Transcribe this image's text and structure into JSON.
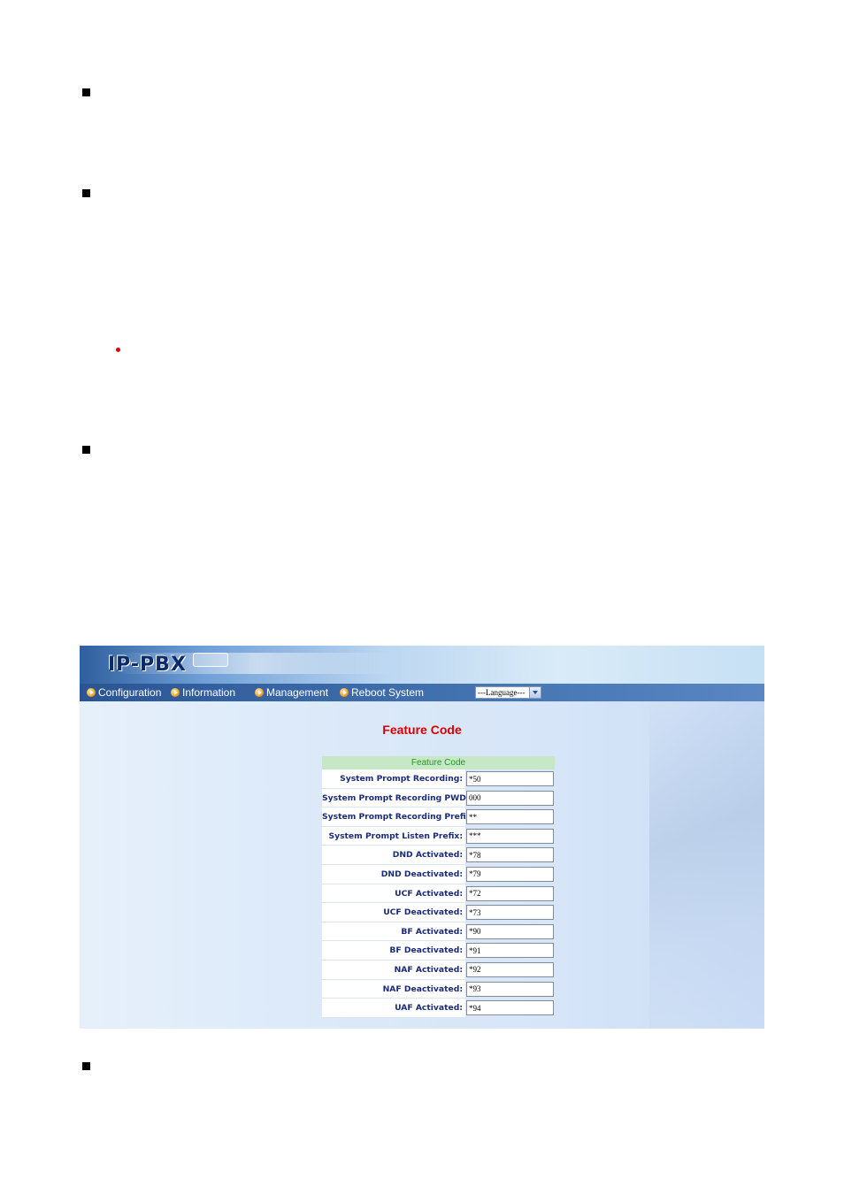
{
  "app": {
    "logo_text": "IP-PBX",
    "menu": [
      {
        "label": "Configuration",
        "icon": "arrow-circle-icon"
      },
      {
        "label": "Information",
        "icon": "arrow-circle-icon"
      },
      {
        "label": "Management",
        "icon": "arrow-circle-icon"
      },
      {
        "label": "Reboot System",
        "icon": "arrow-circle-icon"
      }
    ],
    "language_select": {
      "selected": "---Language---"
    }
  },
  "page": {
    "title": "Feature Code",
    "table_header": "Feature Code",
    "rows": [
      {
        "label": "System Prompt Recording:",
        "value": "*50"
      },
      {
        "label": "System Prompt Recording PWD:",
        "value": "000"
      },
      {
        "label": "System Prompt Recording Prefix:",
        "value": "**"
      },
      {
        "label": "System Prompt Listen Prefix:",
        "value": "***"
      },
      {
        "label": "DND Activated:",
        "value": "*78"
      },
      {
        "label": "DND Deactivated:",
        "value": "*79"
      },
      {
        "label": "UCF Activated:",
        "value": "*72"
      },
      {
        "label": "UCF Deactivated:",
        "value": "*73"
      },
      {
        "label": "BF Activated:",
        "value": "*90"
      },
      {
        "label": "BF Deactivated:",
        "value": "*91"
      },
      {
        "label": "NAF Activated:",
        "value": "*92"
      },
      {
        "label": "NAF Deactivated:",
        "value": "*93"
      },
      {
        "label": "UAF Activated:",
        "value": "*94"
      }
    ]
  },
  "colors": {
    "title_red": "#d80000",
    "header_green": "#1b9b1b",
    "label_navy": "#1a2b7a",
    "menubar_blue": "#2a5593"
  }
}
